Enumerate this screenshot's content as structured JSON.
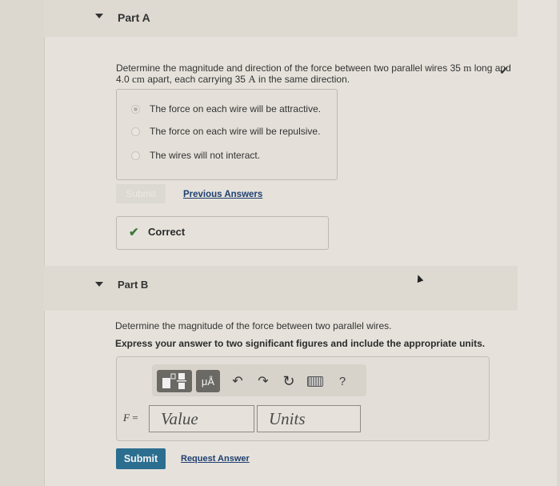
{
  "partA": {
    "title": "Part A",
    "status_icon": "checkmark-icon",
    "question_parts": {
      "t1": "Determine the magnitude and direction of the force between two parallel wires 35 ",
      "u1": "m",
      "t2": " long and",
      "t3": "4.0 ",
      "u2": "cm",
      "t4": " apart, each carrying 35 ",
      "u3": "A",
      "t5": " in the same direction."
    },
    "choices": [
      {
        "label": "The force on each wire will be attractive.",
        "selected": true
      },
      {
        "label": "The force on each wire will be repulsive.",
        "selected": false
      },
      {
        "label": "The wires will not interact.",
        "selected": false
      }
    ],
    "submit_label": "Submit",
    "previous_answers_label": "Previous Answers",
    "feedback": {
      "icon": "checkmark-icon",
      "label": "Correct"
    }
  },
  "partB": {
    "title": "Part B",
    "question": "Determine the magnitude of the force between two parallel wires.",
    "instruction": "Express your answer to two significant figures and include the appropriate units.",
    "toolbar": {
      "units_label": "μÅ",
      "undo": "↶",
      "redo": "↷",
      "reset": "↻",
      "help": "?"
    },
    "variable_label": "F",
    "equals": " =",
    "value_placeholder": "Value",
    "units_placeholder": "Units",
    "submit_label": "Submit",
    "request_answer_label": "Request Answer"
  }
}
